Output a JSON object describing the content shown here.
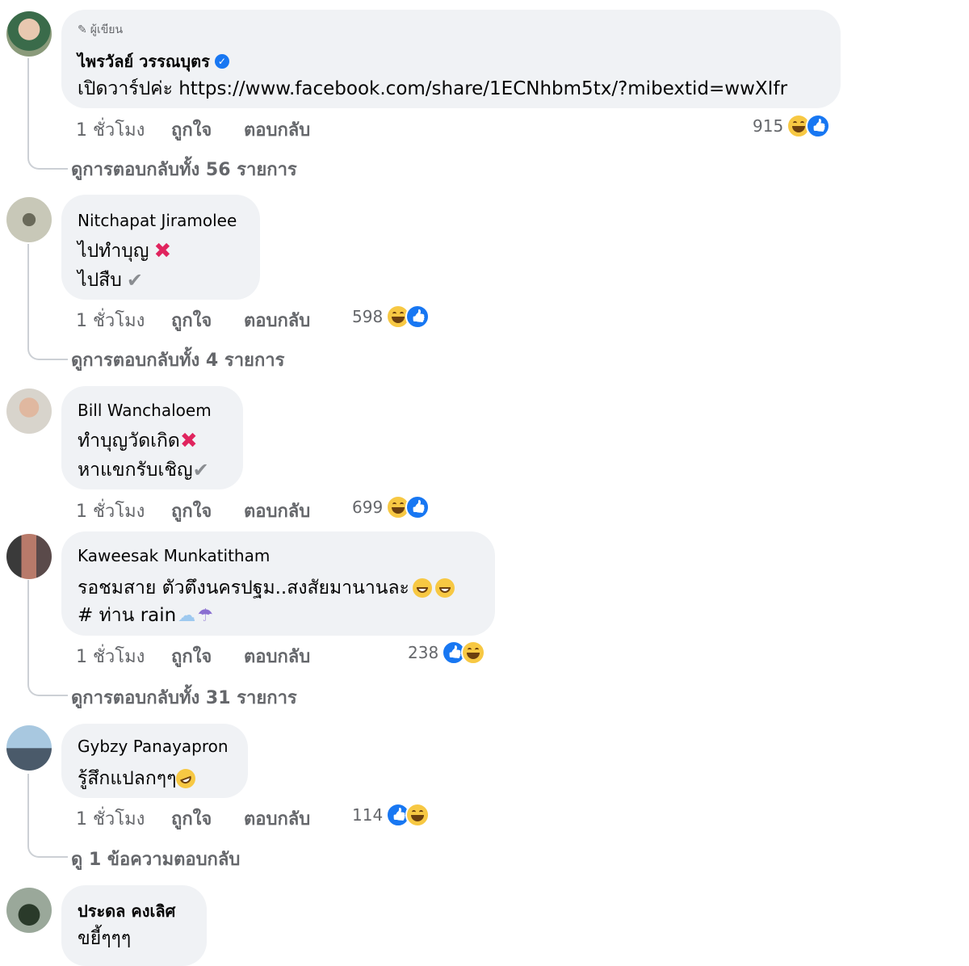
{
  "comments": [
    {
      "author_badge": "ผู้เขียน",
      "name": "ไพรวัลย์ วรรณบุตร",
      "verified": true,
      "lines": [
        "เปิดวาร์ปค่ะ https://www.facebook.com/share/1ECNhbm5tx/?mibextid=wwXIfr"
      ],
      "time": "1 ชั่วโมง",
      "like": "ถูกใจ",
      "reply": "ตอบกลับ",
      "reaction_count": "915",
      "reactions": [
        "haha",
        "like"
      ],
      "view_replies": "ดูการตอบกลับทั้ง 56 รายการ"
    },
    {
      "name": "Nitchapat Jiramolee",
      "lines": [
        "ไปทำบุญ",
        "ไปสืบ"
      ],
      "time": "1 ชั่วโมง",
      "like": "ถูกใจ",
      "reply": "ตอบกลับ",
      "reaction_count": "598",
      "reactions": [
        "haha",
        "like"
      ],
      "view_replies": "ดูการตอบกลับทั้ง 4 รายการ"
    },
    {
      "name": "Bill Wanchaloem",
      "lines": [
        "ทำบุญวัดเกิด",
        "หาแขกรับเชิญ"
      ],
      "time": "1 ชั่วโมง",
      "like": "ถูกใจ",
      "reply": "ตอบกลับ",
      "reaction_count": "699",
      "reactions": [
        "haha",
        "like"
      ]
    },
    {
      "name": "Kaweesak Munkatitham",
      "lines": [
        "รอชมสาย ตัวตึงนครปฐม..สงสัยมานานละ",
        "# ท่าน rain"
      ],
      "time": "1 ชั่วโมง",
      "like": "ถูกใจ",
      "reply": "ตอบกลับ",
      "reaction_count": "238",
      "reactions": [
        "like",
        "haha"
      ],
      "view_replies": "ดูการตอบกลับทั้ง 31 รายการ"
    },
    {
      "name": "Gybzy Panayapron",
      "lines": [
        "รู้สึกแปลกๆๆ"
      ],
      "time": "1 ชั่วโมง",
      "like": "ถูกใจ",
      "reply": "ตอบกลับ",
      "reaction_count": "114",
      "reactions": [
        "like",
        "haha"
      ],
      "view_replies": "ดู 1 ข้อความตอบกลับ"
    },
    {
      "name": "ประดล คงเลิศ",
      "lines": [
        "ขยี้ๆๆๆ"
      ]
    }
  ]
}
